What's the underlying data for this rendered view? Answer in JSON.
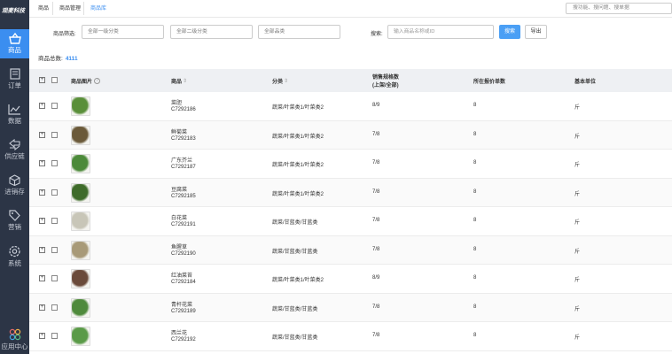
{
  "app": {
    "logo": "观麦科技"
  },
  "sidebar": {
    "items": [
      {
        "label": "商品",
        "icon": "basket-icon",
        "active": true
      },
      {
        "label": "订单",
        "icon": "order-icon"
      },
      {
        "label": "数据",
        "icon": "chart-icon"
      },
      {
        "label": "供应链",
        "icon": "exchange-icon"
      },
      {
        "label": "进销存",
        "icon": "box-icon"
      },
      {
        "label": "营销",
        "icon": "tag-icon"
      },
      {
        "label": "系统",
        "icon": "gear-icon"
      },
      {
        "label": "应用中心",
        "icon": "apps-icon"
      }
    ]
  },
  "tabs": [
    "商品",
    "商品管理",
    "商品库"
  ],
  "top_search": {
    "placeholder": "搜功能、搜问题、搜单据"
  },
  "filters": {
    "label": "商品筛选:",
    "level1": "全部一级分类",
    "level2": "全部二级分类",
    "brand": "全部品类",
    "search_label": "搜索:",
    "search_placeholder": "输入商品名称或ID",
    "search_button": "搜索",
    "export_button": "导出"
  },
  "summary": {
    "label": "商品总数:",
    "count": "4111"
  },
  "columns": {
    "image": "商品图片",
    "product": "商品",
    "category": "分类",
    "spec_line1": "销售规格数",
    "spec_line2": "(上架/全部)",
    "quote": "所在报价单数",
    "unit": "基本单位"
  },
  "rows": [
    {
      "name": "菜胆",
      "id": "C7292186",
      "category": "蔬菜/叶菜类1/叶菜类2",
      "specs": "8/9",
      "quotes": "8",
      "unit": "斤",
      "thumb_color": "#5a8f3a"
    },
    {
      "name": "鲜菊菜",
      "id": "C7292183",
      "category": "蔬菜/叶菜类1/叶菜类2",
      "specs": "7/8",
      "quotes": "8",
      "unit": "斤",
      "thumb_color": "#6b5a3a"
    },
    {
      "name": "广东芥兰",
      "id": "C7292187",
      "category": "蔬菜/叶菜类1/叶菜类2",
      "specs": "7/8",
      "quotes": "8",
      "unit": "斤",
      "thumb_color": "#4c8a3a"
    },
    {
      "name": "豆腐菜",
      "id": "C7292185",
      "category": "蔬菜/叶菜类1/叶菜类2",
      "specs": "7/8",
      "quotes": "8",
      "unit": "斤",
      "thumb_color": "#3e6b2a"
    },
    {
      "name": "白花菜",
      "id": "C7292191",
      "category": "蔬菜/甘蓝类/甘蓝类",
      "specs": "7/8",
      "quotes": "8",
      "unit": "斤",
      "thumb_color": "#c8c6b8"
    },
    {
      "name": "鱼腥草",
      "id": "C7292190",
      "category": "蔬菜/甘蓝类/甘蓝类",
      "specs": "7/8",
      "quotes": "8",
      "unit": "斤",
      "thumb_color": "#a89a78"
    },
    {
      "name": "红油菜苔",
      "id": "C7292184",
      "category": "蔬菜/叶菜类1/叶菜类2",
      "specs": "8/9",
      "quotes": "8",
      "unit": "斤",
      "thumb_color": "#6a4a3a"
    },
    {
      "name": "青杆花菜",
      "id": "C7292189",
      "category": "蔬菜/甘蓝类/甘蓝类",
      "specs": "7/8",
      "quotes": "8",
      "unit": "斤",
      "thumb_color": "#4f8a3c"
    },
    {
      "name": "西兰花",
      "id": "C7292192",
      "category": "蔬菜/甘蓝类/甘蓝类",
      "specs": "7/8",
      "quotes": "8",
      "unit": "斤",
      "thumb_color": "#5a9a48"
    }
  ]
}
